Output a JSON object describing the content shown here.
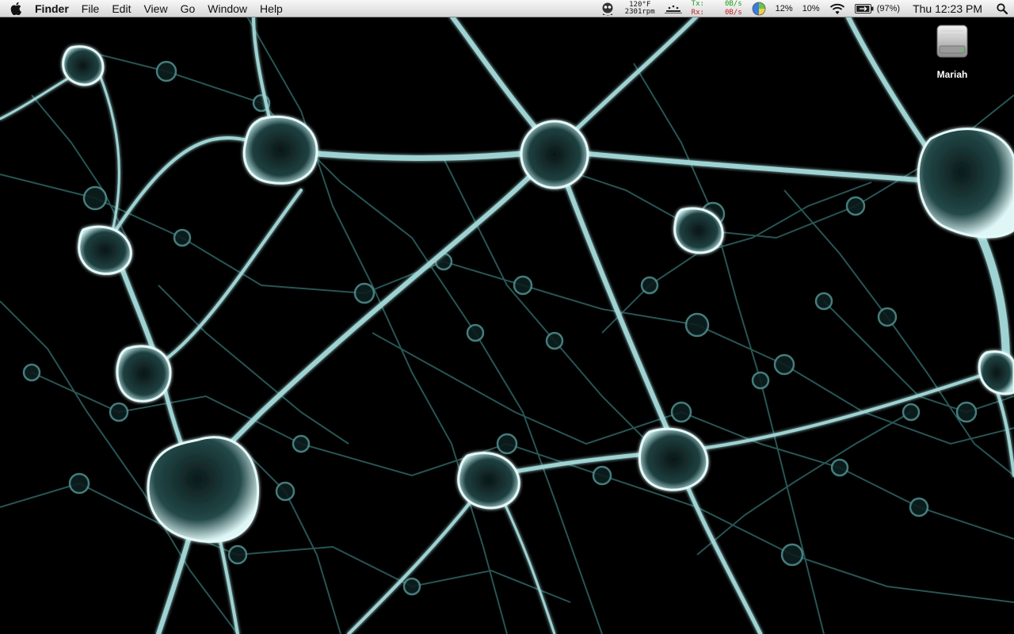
{
  "menubar": {
    "app_name": "Finder",
    "menus": [
      "File",
      "Edit",
      "View",
      "Go",
      "Window",
      "Help"
    ]
  },
  "status": {
    "temperature": "120°F",
    "fan_speed": "2301rpm",
    "net": {
      "tx_label": "Tx:",
      "tx_value": "0B/s",
      "rx_label": "Rx:",
      "rx_value": "0B/s"
    },
    "cpu_percent": "12%",
    "mem_percent": "10%",
    "battery": "(97%)",
    "battery_level": 0.97,
    "clock": "Thu 12:23 PM"
  },
  "desktop": {
    "drive_label": "Mariah"
  },
  "icons": [
    "apple-icon",
    "system-monitor-icon",
    "dock-icon",
    "cpu-pie-icon",
    "wifi-icon",
    "battery-icon",
    "spotlight-search-icon",
    "hard-drive-icon"
  ],
  "colors": {
    "menubar_top": "#f7f7f7",
    "menubar_bottom": "#d6d6d6",
    "wallpaper_background": "#000000",
    "neuron_tint": "#cfeeee",
    "tx_color": "#1a9a1a",
    "rx_color": "#c02020"
  }
}
